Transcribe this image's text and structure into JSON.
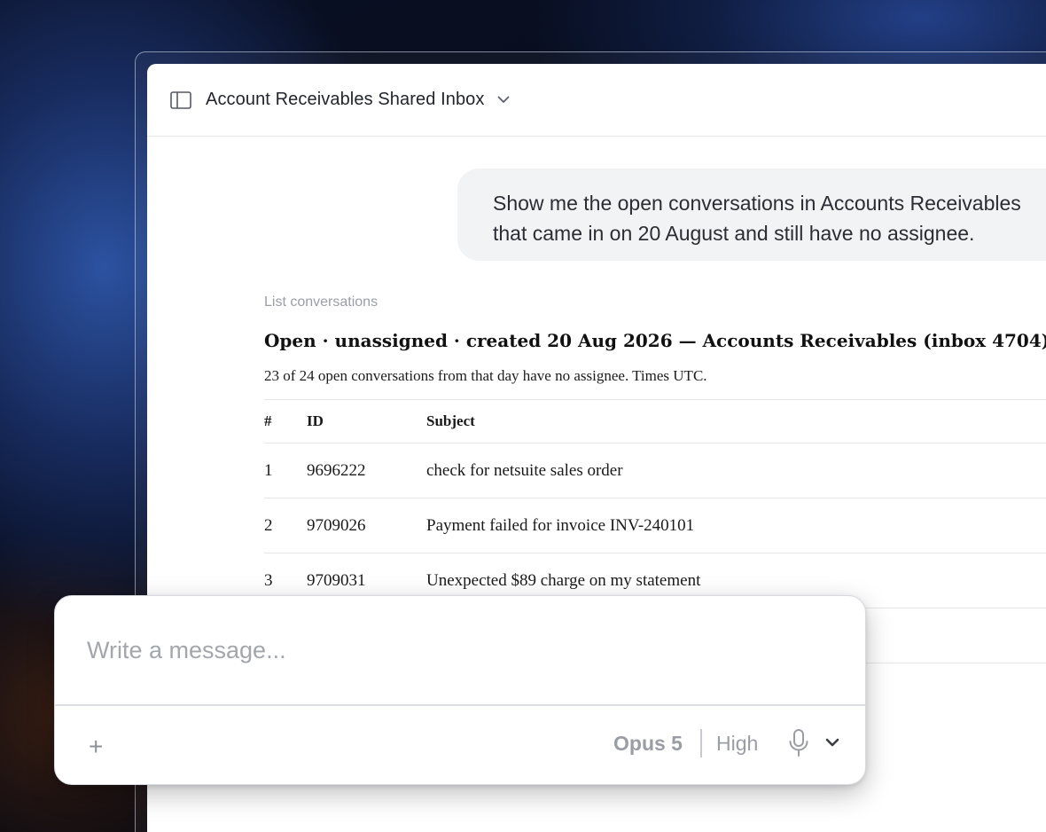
{
  "header": {
    "title": "Account Receivables Shared Inbox",
    "sidebar_icon": "sidebar-toggle-icon",
    "dropdown_icon": "chevron-down-icon"
  },
  "user_message": {
    "line1": "Show me the open conversations in Accounts Receivables",
    "line2": "that came in on 20 August and still have no assignee."
  },
  "tool": {
    "label": "List conversations"
  },
  "result": {
    "title": "Open · unassigned · created 20 Aug 2026 — Accounts Receivables (inbox 4704)",
    "subtitle": "23 of 24 open conversations from that day have no assignee. Times UTC.",
    "columns": [
      "#",
      "ID",
      "Subject"
    ],
    "rows": [
      {
        "num": "1",
        "id": "9696222",
        "subject": "check for netsuite sales order"
      },
      {
        "num": "2",
        "id": "9709026",
        "subject": "Payment failed for invoice INV-240101"
      },
      {
        "num": "3",
        "id": "9709031",
        "subject": "Unexpected $89 charge on my statement"
      }
    ]
  },
  "composer": {
    "placeholder": "Write a message...",
    "plus_label": "+",
    "model": "Opus 5",
    "effort": "High",
    "mic_icon": "microphone-icon",
    "options_icon": "chevron-down-icon"
  }
}
